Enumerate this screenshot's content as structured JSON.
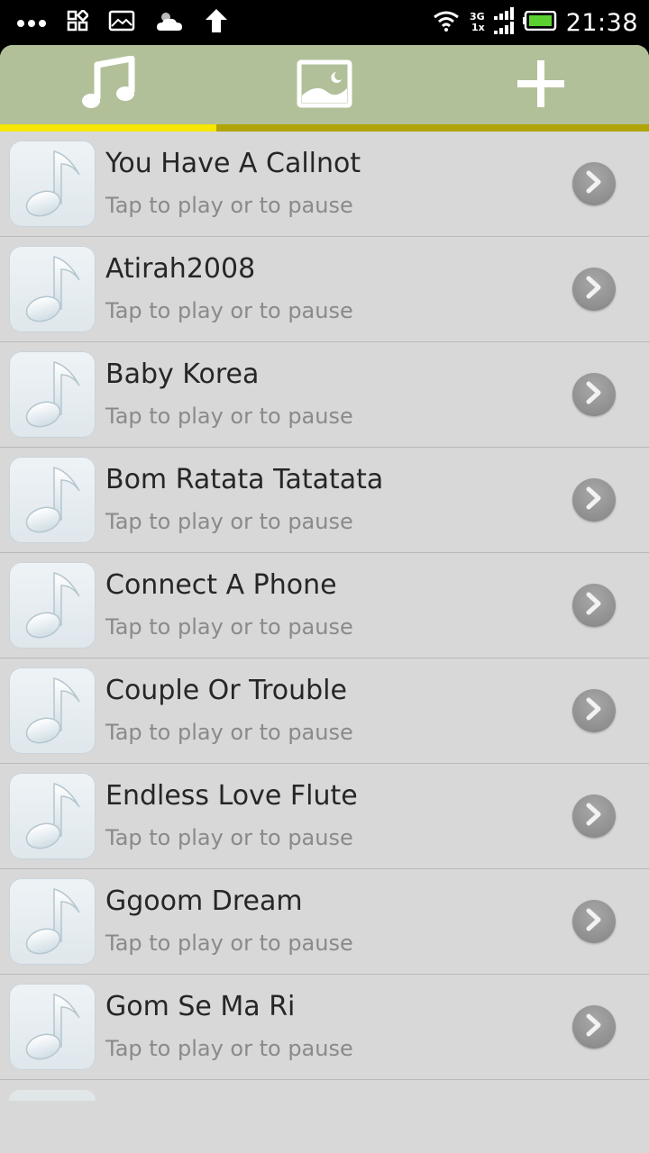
{
  "status_bar": {
    "time": "21:38",
    "network_top": "3G",
    "network_bottom": "1x",
    "icons": [
      "more-dots-icon",
      "apps-grid-icon",
      "image-notification-icon",
      "weather-cloud-icon",
      "upload-arrow-icon",
      "wifi-icon",
      "signal-icon",
      "battery-icon"
    ]
  },
  "tabs": [
    {
      "name": "music",
      "icon": "music-note-icon",
      "active": true
    },
    {
      "name": "images",
      "icon": "image-icon",
      "active": false
    },
    {
      "name": "add",
      "icon": "plus-icon",
      "active": false
    }
  ],
  "colors": {
    "tabbar": "#b1c099",
    "active_indicator": "#f6e600",
    "indicator_track": "#b1a409",
    "list_bg": "#d8d8d8"
  },
  "songs": [
    {
      "title": "You Have A Callnot",
      "subtitle": "Tap to play or to pause"
    },
    {
      "title": "Atirah2008",
      "subtitle": "Tap to play or to pause"
    },
    {
      "title": "Baby Korea",
      "subtitle": "Tap to play or to pause"
    },
    {
      "title": "Bom Ratata Tatatata",
      "subtitle": "Tap to play or to pause"
    },
    {
      "title": "Connect A Phone",
      "subtitle": "Tap to play or to pause"
    },
    {
      "title": "Couple Or Trouble",
      "subtitle": "Tap to play or to pause"
    },
    {
      "title": "Endless Love Flute",
      "subtitle": "Tap to play or to pause"
    },
    {
      "title": "Ggoom Dream",
      "subtitle": "Tap to play or to pause"
    },
    {
      "title": "Gom Se Ma Ri",
      "subtitle": "Tap to play or to pause"
    }
  ]
}
